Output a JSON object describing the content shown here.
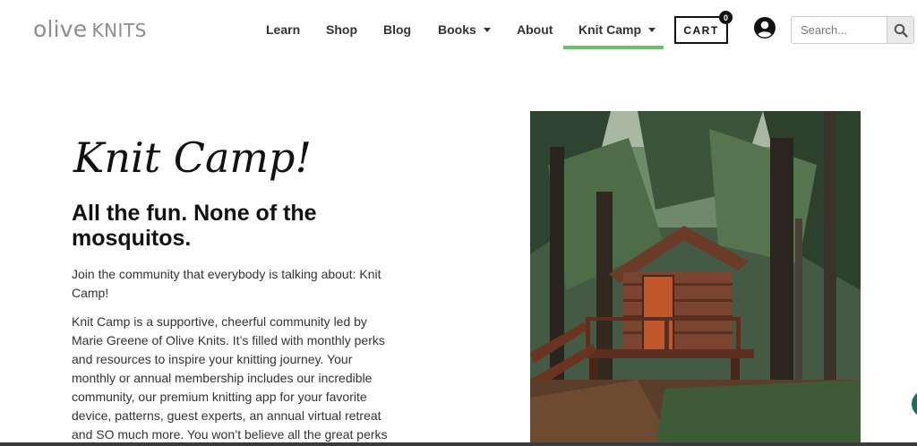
{
  "brand": {
    "logo_main": "olive",
    "logo_sub": "KNITS"
  },
  "nav": {
    "items": [
      {
        "label": "Learn"
      },
      {
        "label": "Shop"
      },
      {
        "label": "Blog"
      },
      {
        "label": "Books"
      },
      {
        "label": "About"
      },
      {
        "label": "Knit Camp"
      }
    ],
    "active_label": "Knit Camp",
    "active_color": "#6cc06d"
  },
  "cart": {
    "label": "CART",
    "count": "0"
  },
  "search": {
    "placeholder": "Search..."
  },
  "icons": [
    "account-icon",
    "search-icon",
    "chevron-down-icon",
    "chat-icon"
  ],
  "hero": {
    "script_title": "Knit Camp!",
    "headline": "All the fun. None of the mosquitos.",
    "intro": "Join the community that everybody is talking about: Knit Camp!",
    "body": "Knit Camp is a supportive, cheerful community led by Marie Greene of Olive Knits. It’s filled with monthly perks and resources to inspire your knitting journey. Your monthly or annual membership includes our incredible community, our premium knitting app for your favorite device, patterns, guest experts, an annual virtual retreat and SO much more. You won’t believe all the great perks"
  },
  "colors": {
    "accent": "#6cc06d",
    "text": "#333333",
    "chat": "#1d6b60"
  }
}
